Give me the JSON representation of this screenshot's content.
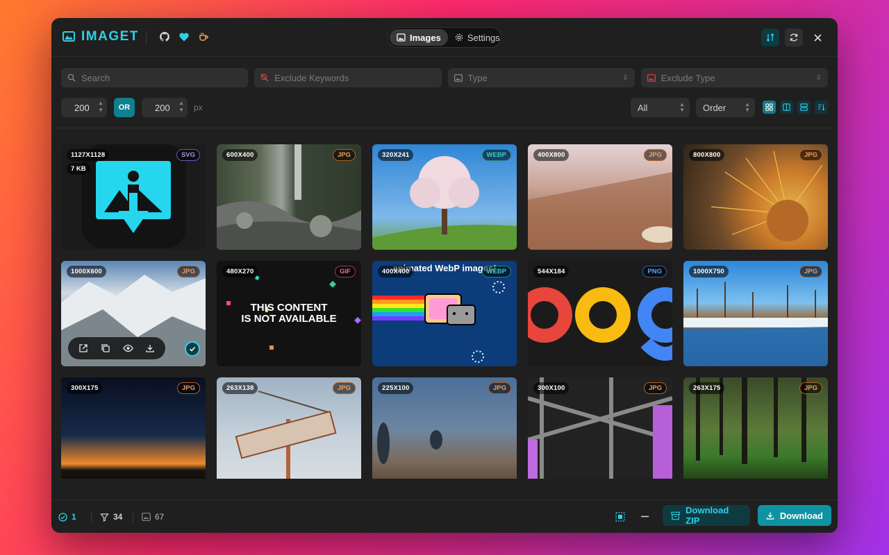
{
  "app": {
    "brand": "IMAGET"
  },
  "header": {
    "tabs": [
      {
        "label": "Images",
        "active": true
      },
      {
        "label": "Settings",
        "active": false
      }
    ]
  },
  "filters": {
    "search_placeholder": "Search",
    "exclude_keywords_placeholder": "Exclude Keywords",
    "type_placeholder": "Type",
    "exclude_type_placeholder": "Exclude Type",
    "min_size": "200",
    "or_label": "OR",
    "max_size": "200",
    "unit": "px",
    "scope_value": "All",
    "order_value": "Order"
  },
  "cards": [
    {
      "size": "1127X1128",
      "filesize": "7 KB",
      "type": "SVG"
    },
    {
      "size": "600X400",
      "type": "JPG"
    },
    {
      "size": "320X241",
      "type": "WEBP"
    },
    {
      "size": "400X800",
      "type": "JPG"
    },
    {
      "size": "800X800",
      "type": "JPG"
    },
    {
      "size": "1000X600",
      "type": "JPG"
    },
    {
      "size": "480X270",
      "type": "GIF",
      "overlay": "THIS CONTENT\nIS NOT AVAILABLE"
    },
    {
      "size": "400X400",
      "type": "WEBP",
      "overlay": "animated WebP images!"
    },
    {
      "size": "544X184",
      "type": "PNG"
    },
    {
      "size": "1000X750",
      "type": "JPG"
    },
    {
      "size": "300X175",
      "type": "JPG"
    },
    {
      "size": "263X138",
      "type": "JPG"
    },
    {
      "size": "225X100",
      "type": "JPG"
    },
    {
      "size": "300X100",
      "type": "JPG"
    },
    {
      "size": "263X175",
      "type": "JPG"
    }
  ],
  "footer": {
    "selected_count": "1",
    "filtered_count": "34",
    "total_count": "67",
    "download_zip_label": "Download ZIP",
    "download_label": "Download"
  },
  "colors": {
    "accent": "#2fcfe6",
    "primary_button": "#0f93a3"
  }
}
